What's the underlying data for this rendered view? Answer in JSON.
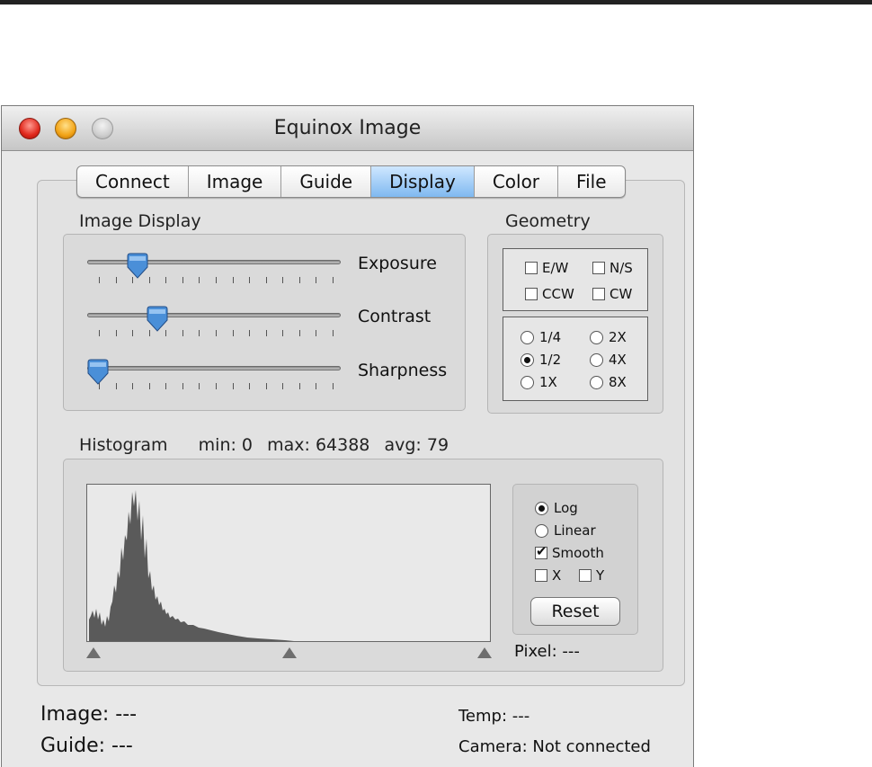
{
  "window": {
    "title": "Equinox Image"
  },
  "tabs": [
    {
      "label": "Connect",
      "active": false
    },
    {
      "label": "Image",
      "active": false
    },
    {
      "label": "Guide",
      "active": false
    },
    {
      "label": "Display",
      "active": true
    },
    {
      "label": "Color",
      "active": false
    },
    {
      "label": "File",
      "active": false
    }
  ],
  "image_display": {
    "title": "Image Display",
    "sliders": [
      {
        "label": "Exposure",
        "value_fraction": 0.2
      },
      {
        "label": "Contrast",
        "value_fraction": 0.28
      },
      {
        "label": "Sharpness",
        "value_fraction": 0.0
      }
    ]
  },
  "geometry": {
    "title": "Geometry",
    "checkboxes": [
      {
        "label": "E/W",
        "checked": false
      },
      {
        "label": "N/S",
        "checked": false
      },
      {
        "label": "CCW",
        "checked": false
      },
      {
        "label": "CW",
        "checked": false
      }
    ],
    "scale_options": [
      {
        "label": "1/4",
        "selected": false
      },
      {
        "label": "2X",
        "selected": false
      },
      {
        "label": "1/2",
        "selected": true
      },
      {
        "label": "4X",
        "selected": false
      },
      {
        "label": "1X",
        "selected": false
      },
      {
        "label": "8X",
        "selected": false
      }
    ]
  },
  "histogram": {
    "title": "Histogram",
    "min_label": "min: 0",
    "max_label": "max: 64388",
    "avg_label": "avg: 79",
    "options": {
      "log_label": "Log",
      "log_selected": true,
      "linear_label": "Linear",
      "linear_selected": false,
      "smooth_label": "Smooth",
      "smooth_checked": true,
      "x_label": "X",
      "x_checked": false,
      "y_label": "Y",
      "y_checked": false
    },
    "reset_label": "Reset",
    "pixel_label": "Pixel: ---"
  },
  "status": {
    "image": "Image: ---",
    "guide": "Guide: ---",
    "temp": "Temp: ---",
    "camera": "Camera: Not connected"
  },
  "colors": {
    "active_tab": "#7fb9f0",
    "slider_knob": "#4a8fd8",
    "histogram_fill": "#5a5a5a",
    "close_button": "#e0281c",
    "minimize_button": "#f2a316"
  }
}
